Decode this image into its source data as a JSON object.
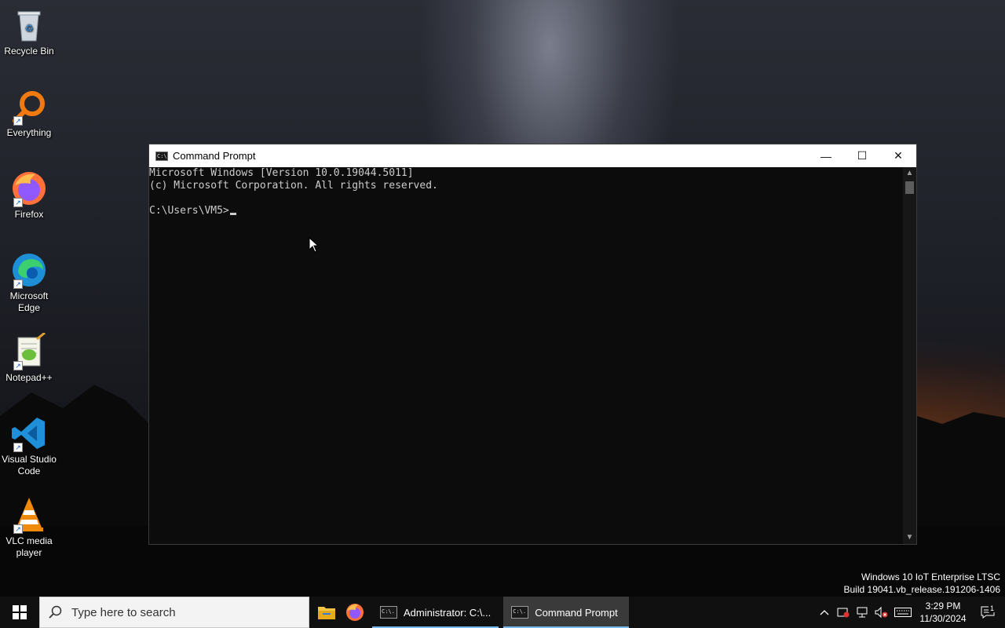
{
  "desktop": {
    "icons": [
      {
        "label": "Recycle Bin"
      },
      {
        "label": "Everything"
      },
      {
        "label": "Firefox"
      },
      {
        "label": "Microsoft Edge"
      },
      {
        "label": "Notepad++"
      },
      {
        "label": "Visual Studio Code"
      },
      {
        "label": "VLC media player"
      }
    ],
    "watermark": {
      "line1": "Windows 10 IoT Enterprise LTSC",
      "line2": "Build 19041.vb_release.191206-1406"
    }
  },
  "cmd_window": {
    "title": "Command Prompt",
    "icon_text": "C:\\.",
    "lines": [
      "Microsoft Windows [Version 10.0.19044.5011]",
      "(c) Microsoft Corporation. All rights reserved.",
      "",
      "C:\\Users\\VM5>"
    ],
    "buttons": {
      "minimize": "—",
      "maximize": "☐",
      "close": "✕"
    }
  },
  "taskbar": {
    "search_placeholder": "Type here to search",
    "tasks": [
      {
        "label": "Administrator: C:\\...",
        "active": false
      },
      {
        "label": "Command Prompt",
        "active": true
      }
    ],
    "clock": {
      "time": "3:29 PM",
      "date": "11/30/2024"
    },
    "notification_count": "1"
  },
  "colors": {
    "console_bg": "#0c0c0c",
    "console_text": "#cccccc",
    "taskbar_bg": "#101010",
    "accent": "#76b9ed"
  }
}
